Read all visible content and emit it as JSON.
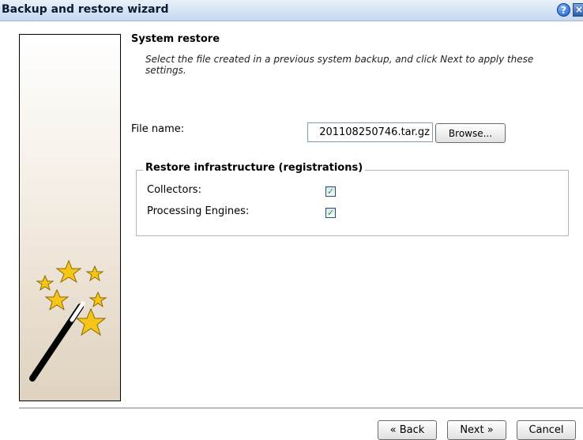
{
  "window": {
    "title": "Backup and restore wizard",
    "help_icon": "?",
    "close_icon": "×"
  },
  "side_panel": {
    "art": "magic-wand-stars"
  },
  "page": {
    "title": "System restore",
    "instructions": "Select the file created in a previous system backup, and click Next to apply these settings."
  },
  "file": {
    "label": "File name:",
    "value": "201108250746.tar.gz",
    "browse_label": "Browse..."
  },
  "restore": {
    "legend": "Restore infrastructure (registrations)",
    "items": [
      {
        "label": "Collectors:",
        "checked": true
      },
      {
        "label": "Processing Engines:",
        "checked": true
      }
    ]
  },
  "buttons": {
    "back": "« Back",
    "next": "Next »",
    "cancel": "Cancel"
  },
  "colors": {
    "star": "#f5c518",
    "title_bar": "#c5d7ef"
  }
}
